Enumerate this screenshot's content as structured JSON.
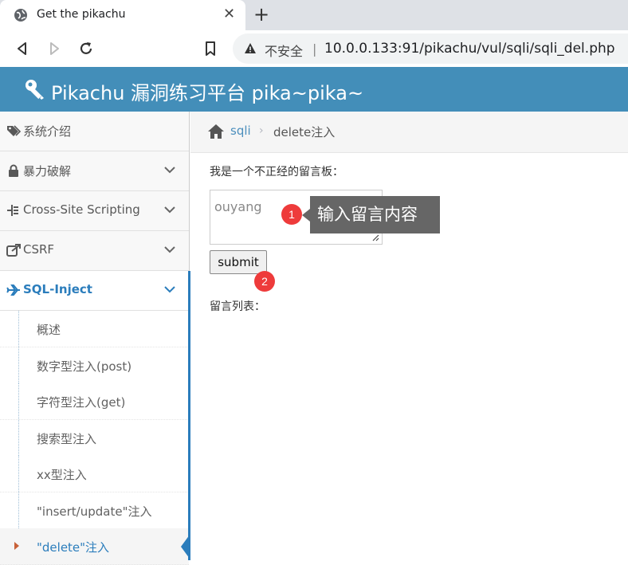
{
  "browser": {
    "tab_title": "Get the pikachu",
    "tab_close": "✕",
    "new_tab": "+",
    "insecure_label": "不安全",
    "separator": "|",
    "url": "10.0.0.133:91/pikachu/vul/sqli/sqli_del.php"
  },
  "header": {
    "title": "Pikachu 漏洞练习平台 pika~pika~"
  },
  "sidebar": {
    "items": [
      {
        "label": "系统介绍",
        "icon": "tags-icon"
      },
      {
        "label": "暴力破解",
        "icon": "lock-icon"
      },
      {
        "label": "Cross-Site Scripting",
        "icon": "sitemap-icon"
      },
      {
        "label": "CSRF",
        "icon": "share-icon"
      },
      {
        "label": "SQL-Inject",
        "icon": "plane-icon"
      }
    ],
    "sub_items": [
      {
        "label": "概述"
      },
      {
        "label": "数字型注入(post)"
      },
      {
        "label": "字符型注入(get)"
      },
      {
        "label": "搜索型注入"
      },
      {
        "label": "xx型注入"
      },
      {
        "label": "\"insert/update\"注入"
      },
      {
        "label": "\"delete\"注入"
      }
    ]
  },
  "breadcrumb": {
    "link": "sqli",
    "sep": "›",
    "current": "delete注入"
  },
  "main": {
    "board_label": "我是一个不正经的留言板：",
    "message_value": "ouyang",
    "submit_label": "submit",
    "list_label": "留言列表："
  },
  "annotations": {
    "badge_1": "1",
    "badge_2": "2",
    "callout_text": "输入留言内容"
  },
  "colors": {
    "header_bg": "#438eb9",
    "accent": "#2b7dbc",
    "badge": "#ee3b3b"
  }
}
